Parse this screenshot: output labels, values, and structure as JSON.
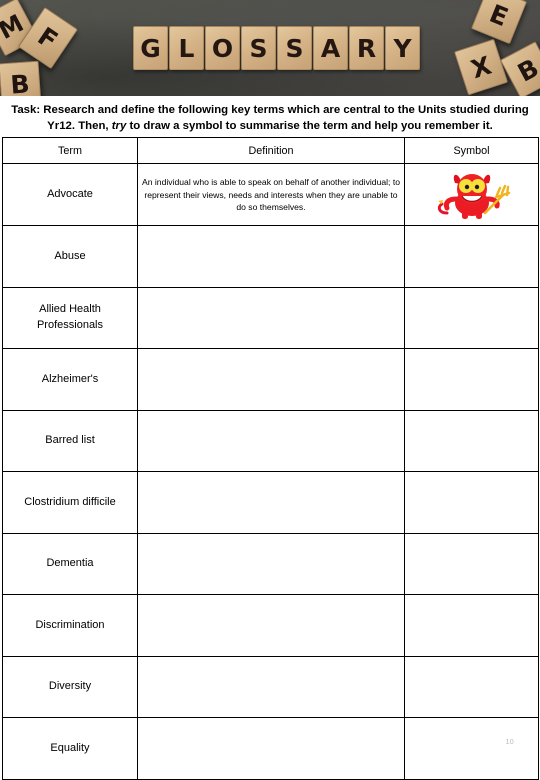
{
  "hero": {
    "headline_word": "GLOSSARY",
    "headline_letters": [
      "G",
      "L",
      "O",
      "S",
      "S",
      "A",
      "R",
      "Y"
    ],
    "scattered_letters": [
      "M",
      "F",
      "B",
      "E",
      "X",
      "B"
    ],
    "background_color": "#4a4a46",
    "tile_color": "#d6b488",
    "letter_color": "#241611"
  },
  "task": {
    "label": "Task:",
    "text_before_em": " Research and define the following key terms which are central to the Units studied during Yr12. Then, ",
    "em_word": "try",
    "text_after_em": " to draw a symbol to summarise the term and help you remember it."
  },
  "table": {
    "headers": {
      "term": "Term",
      "definition": "Definition",
      "symbol": "Symbol"
    },
    "rows": [
      {
        "term": "Advocate",
        "definition": "An individual who is able to speak on behalf of another individual; to represent their views, needs and interests when they are unable to do so themselves.",
        "symbol": "red-devil-clipart"
      },
      {
        "term": "Abuse",
        "definition": "",
        "symbol": ""
      },
      {
        "term": "Allied Health Professionals",
        "definition": "",
        "symbol": ""
      },
      {
        "term": "Alzheimer's",
        "definition": "",
        "symbol": ""
      },
      {
        "term": "Barred list",
        "definition": "",
        "symbol": ""
      },
      {
        "term": "Clostridium difficile",
        "definition": "",
        "symbol": ""
      },
      {
        "term": "Dementia",
        "definition": "",
        "symbol": ""
      },
      {
        "term": "Discrimination",
        "definition": "",
        "symbol": ""
      },
      {
        "term": "Diversity",
        "definition": "",
        "symbol": ""
      },
      {
        "term": "Equality",
        "definition": "",
        "symbol": ""
      }
    ]
  },
  "footer": {
    "page_number": "10"
  }
}
